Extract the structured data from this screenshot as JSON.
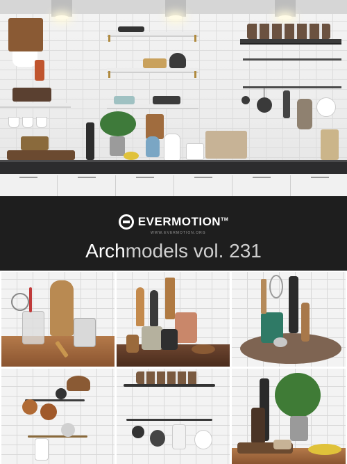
{
  "banner": {
    "brand": "EVERMOTION",
    "brand_mark": "TM",
    "site": "WWW.EVERMOTION.ORG",
    "title_bold": "Arch",
    "title_rest": "models vol. 231"
  },
  "icons": {
    "logo": "evermotion-logo-icon"
  },
  "colors": {
    "banner_bg": "#1e1e1e",
    "worktop": "#2c2c2e",
    "tile": "#f3f3f3",
    "wood": "#a96f42"
  }
}
